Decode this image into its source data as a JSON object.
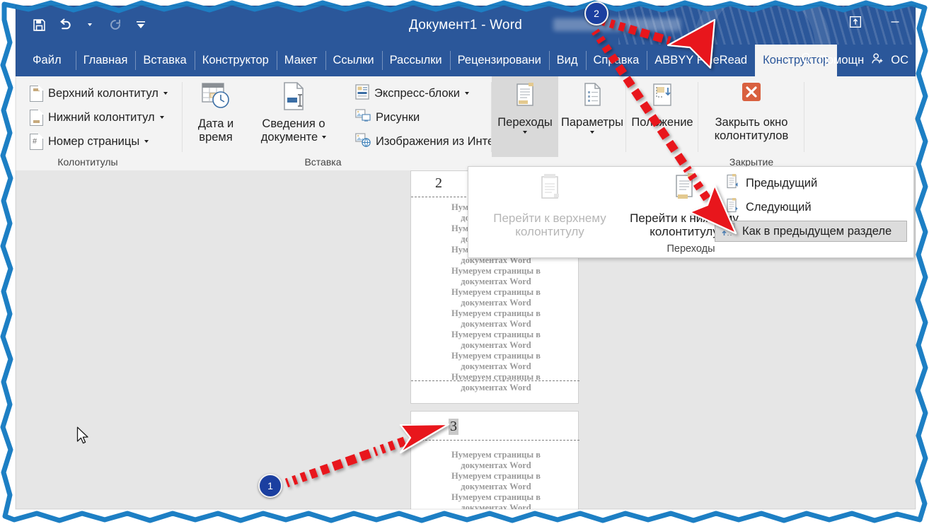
{
  "window": {
    "title": "Документ1  -  Word",
    "account_name_blurred": true
  },
  "quick_access": {
    "items": [
      {
        "name": "save-icon",
        "label": "Сохранить"
      },
      {
        "name": "undo-icon",
        "label": "Отменить"
      },
      {
        "name": "redo-icon",
        "label": "Вернуть"
      },
      {
        "name": "customize-qat-icon",
        "label": "Настройка панели быстрого доступа"
      }
    ]
  },
  "titlebar_right": {
    "ribbon_display_icon": "ribbon-display-options-icon",
    "minimize_icon": "minimize-icon"
  },
  "tabs": [
    {
      "id": "file",
      "label": "Файл"
    },
    {
      "id": "home",
      "label": "Главная"
    },
    {
      "id": "insert",
      "label": "Вставка"
    },
    {
      "id": "design",
      "label": "Конструктор"
    },
    {
      "id": "layout",
      "label": "Макет"
    },
    {
      "id": "references",
      "label": "Ссылки"
    },
    {
      "id": "mailings",
      "label": "Рассылки"
    },
    {
      "id": "review",
      "label": "Рецензировани"
    },
    {
      "id": "view",
      "label": "Вид"
    },
    {
      "id": "help",
      "label": "Справка"
    },
    {
      "id": "abbyy",
      "label": "ABBYY FineRead"
    },
    {
      "id": "hf-design",
      "label": "Конструктор",
      "active": true
    }
  ],
  "tabs_right": {
    "tellme_icon": "lightbulb-icon",
    "tellme_label": "Помощн",
    "share_icon": "person-add-icon",
    "share_label": "ОС"
  },
  "ribbon": {
    "groups": [
      {
        "id": "headers-footers",
        "label": "Колонтитулы",
        "buttons": [
          {
            "name": "header-button",
            "label": "Верхний колонтитул",
            "icon": "header-doc-icon",
            "has_dropdown": true
          },
          {
            "name": "footer-button",
            "label": "Нижний колонтитул",
            "icon": "footer-doc-icon",
            "has_dropdown": true
          },
          {
            "name": "page-number-button",
            "label": "Номер страницы",
            "icon": "page-number-icon",
            "has_dropdown": true
          }
        ]
      },
      {
        "id": "insert",
        "label": "Вставка",
        "big_buttons": [
          {
            "name": "date-time-button",
            "label_line1": "Дата и",
            "label_line2": "время",
            "icon": "calendar-clock-icon"
          },
          {
            "name": "document-info-button",
            "label_line1": "Сведения о",
            "label_line2": "документе",
            "icon": "doc-info-icon",
            "has_dropdown": true
          }
        ],
        "buttons": [
          {
            "name": "quick-parts-button",
            "label": "Экспресс-блоки",
            "icon": "quick-parts-icon",
            "has_dropdown": true
          },
          {
            "name": "pictures-button",
            "label": "Рисунки",
            "icon": "pictures-icon"
          },
          {
            "name": "online-pictures-button",
            "label": "Изображения из Интернета",
            "icon": "online-pictures-icon"
          }
        ]
      },
      {
        "id": "navigation",
        "label": "Переходы",
        "big_buttons": [
          {
            "name": "navigation-button",
            "label": "Переходы",
            "icon": "navigation-icon",
            "has_dropdown": true,
            "selected": true
          }
        ]
      },
      {
        "id": "options",
        "label": "",
        "big_buttons": [
          {
            "name": "options-button",
            "label": "Параметры",
            "icon": "options-icon",
            "has_dropdown": true
          }
        ]
      },
      {
        "id": "position",
        "label": "",
        "big_buttons": [
          {
            "name": "position-button",
            "label": "Положение",
            "icon": "position-icon",
            "has_dropdown": true
          }
        ]
      },
      {
        "id": "close",
        "label": "Закрытие",
        "big_buttons": [
          {
            "name": "close-header-footer-button",
            "label_line1": "Закрыть окно",
            "label_line2": "колонтитулов",
            "icon": "close-x-icon"
          }
        ]
      }
    ]
  },
  "flyout": {
    "group_label": "Переходы",
    "big_items": [
      {
        "name": "goto-header-button",
        "line1": "Перейти к верхнему",
        "line2": "колонтитулу",
        "icon": "goto-header-icon",
        "disabled": true
      },
      {
        "name": "goto-footer-button",
        "line1": "Перейти к нижнему",
        "line2": "колонтитулу",
        "icon": "goto-footer-icon",
        "disabled": false
      }
    ],
    "items": [
      {
        "name": "previous-button",
        "label": "Предыдущий",
        "icon": "previous-section-icon",
        "highlighted": false
      },
      {
        "name": "next-button",
        "label": "Следующий",
        "icon": "next-section-icon",
        "highlighted": false
      },
      {
        "name": "link-to-previous-button",
        "label": "Как в предыдущем разделе",
        "icon": "link-to-previous-icon",
        "highlighted": true
      }
    ]
  },
  "document": {
    "pages": [
      {
        "number": "2",
        "number_selected": false,
        "lines": [
          "Нумеруем страницы в",
          "документах Word",
          "Нумеруем страницы в",
          "документах Word",
          "Нумеруем страницы в",
          "документах Word",
          "Нумеруем страницы в",
          "документах Word",
          "Нумеруем страницы в",
          "документах Word",
          "Нумеруем страницы в",
          "документах Word",
          "Нумеруем страницы в",
          "документах Word",
          "Нумеруем страницы в",
          "документах Word",
          "Нумеруем страницы в",
          "документах Word"
        ]
      },
      {
        "number": "3",
        "number_selected": true,
        "lines": [
          "Нумеруем страницы в",
          "документах Word",
          "Нумеруем страницы в",
          "документах Word",
          "Нумеруем страницы в",
          "документах Word"
        ]
      }
    ]
  },
  "annotations": {
    "accent_color": "#e8131b",
    "badge_color": "#1b3fa0",
    "markers": [
      {
        "id": "1",
        "label": "1"
      },
      {
        "id": "2",
        "label": "2"
      }
    ]
  }
}
